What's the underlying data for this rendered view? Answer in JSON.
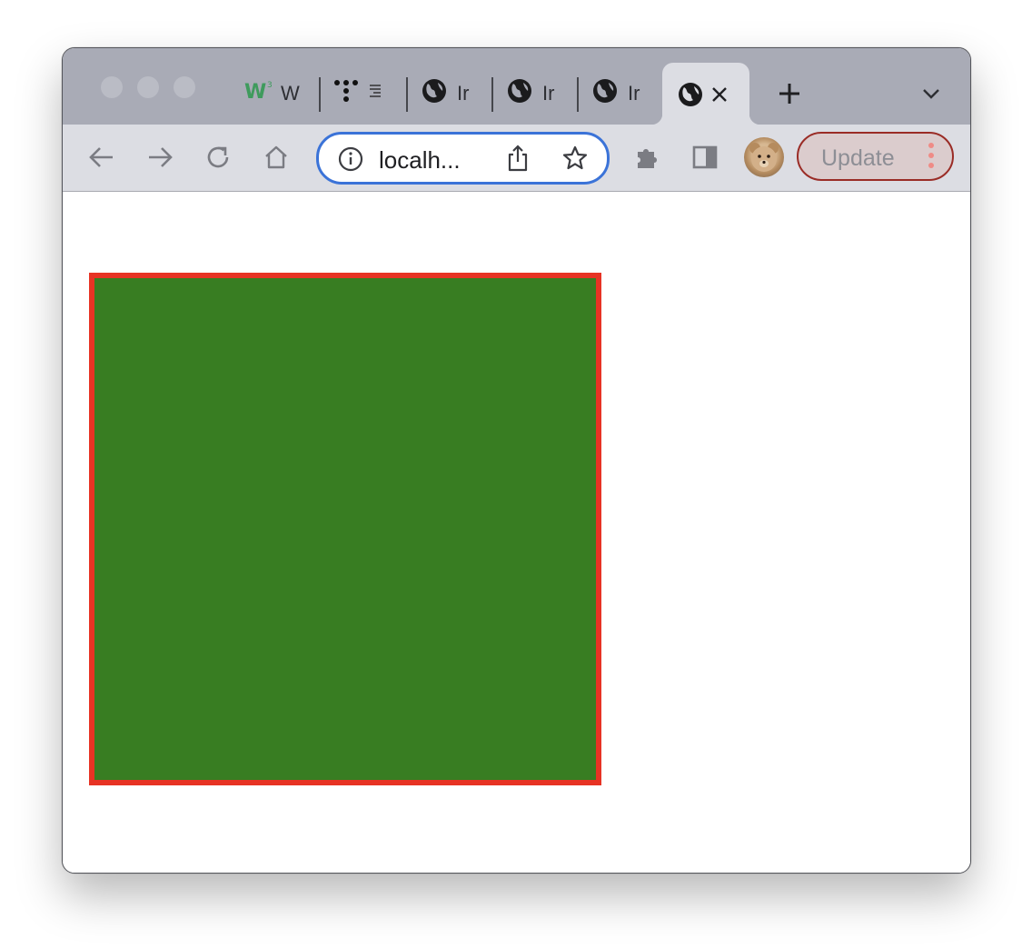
{
  "window": {
    "traffic_lights": [
      "close",
      "minimize",
      "zoom"
    ]
  },
  "tabs": [
    {
      "label": "W",
      "icon": "w3schools-icon",
      "active": false
    },
    {
      "label": "",
      "icon": "dots-icon",
      "active": false
    },
    {
      "label": "Ir",
      "icon": "globe-icon",
      "active": false
    },
    {
      "label": "Ir",
      "icon": "globe-icon",
      "active": false
    },
    {
      "label": "Ir",
      "icon": "globe-icon",
      "active": false
    },
    {
      "label": "",
      "icon": "globe-icon",
      "active": true
    }
  ],
  "toolbar": {
    "url": "localh...",
    "update_label": "Update"
  },
  "page": {
    "box_color": "#387d22",
    "box_border_color": "#e73324"
  },
  "colors": {
    "accent": "#3b73d8",
    "update_border": "#9a2c26"
  }
}
